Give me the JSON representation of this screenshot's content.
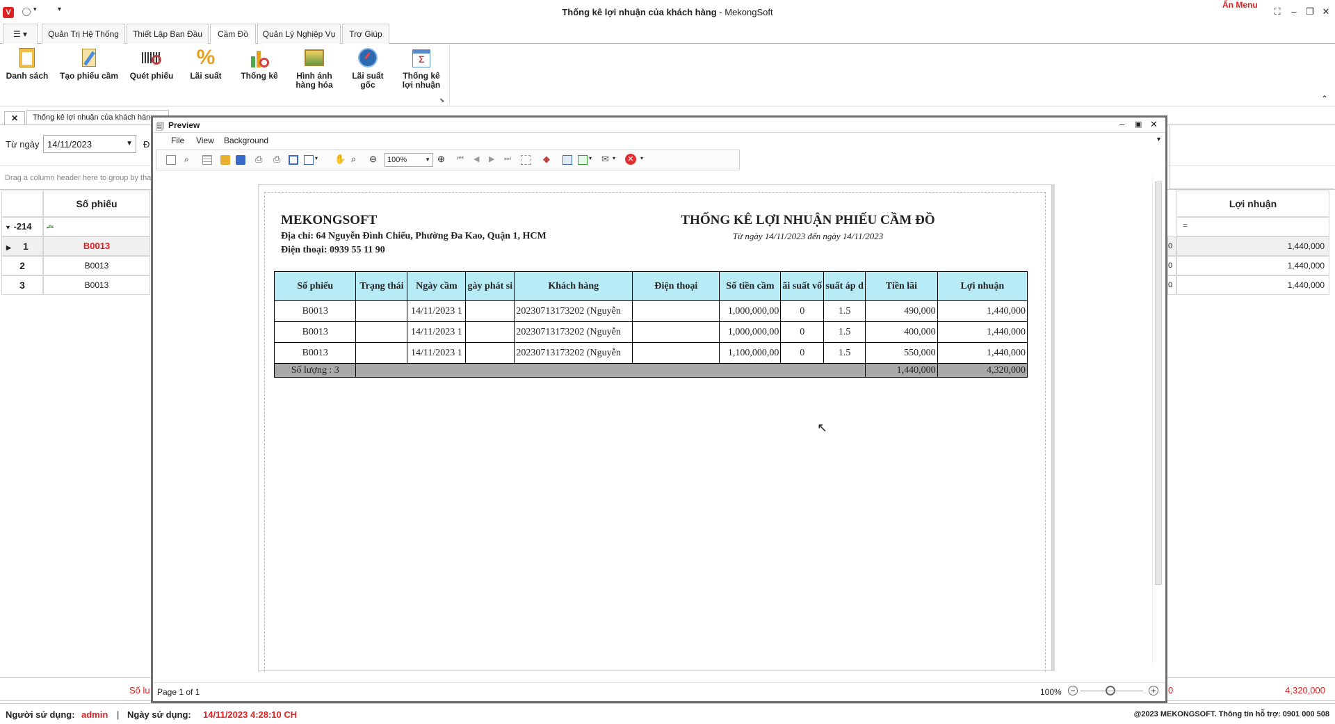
{
  "window": {
    "title_bold": "Thống kê lợi nhuận của khách hàng",
    "title_rest": " - MekongSoft",
    "an_menu": "Ẩn Menu"
  },
  "ribbon_tabs": [
    "Quản Trị Hệ Thống",
    "Thiết Lập Ban Đầu",
    "Cầm Đồ",
    "Quản Lý Nghiệp Vụ",
    "Trợ Giúp"
  ],
  "ribbon_buttons": [
    {
      "label": "Danh sách",
      "icon": "clipboard-icon"
    },
    {
      "label": "Tạo phiếu cầm",
      "icon": "edit-form-icon"
    },
    {
      "label": "Quét phiếu",
      "icon": "scan-barcode-icon"
    },
    {
      "label": "Lãi suất",
      "icon": "percent-icon"
    },
    {
      "label": "Thống kê",
      "icon": "chart-icon"
    },
    {
      "label": "Hình ảnh\nhàng hóa",
      "icon": "image-icon"
    },
    {
      "label": "Lãi suất\ngốc",
      "icon": "gauge-icon"
    },
    {
      "label": "Thống kê\nlợi nhuận",
      "icon": "sum-report-icon"
    }
  ],
  "doc_tab": {
    "close": "✕",
    "label": "Thống kê lợi nhuận của khách hàng"
  },
  "filter": {
    "from_label": "Từ ngày",
    "from_value": "14/11/2023",
    "to_label_partial": "Đ"
  },
  "grid": {
    "group_hint": "Drag a column header here to group by tha",
    "col_so_phieu": "Số phiếu",
    "col_loi_nhuan": "Lợi nhuận",
    "filter_row_value": "-214",
    "rows": [
      {
        "num": "1",
        "so_phieu": "B0013",
        "zero": "0",
        "loi_nhuan": "1,440,000"
      },
      {
        "num": "2",
        "so_phieu": "B0013",
        "zero": "0",
        "loi_nhuan": "1,440,000"
      },
      {
        "num": "3",
        "so_phieu": "B0013",
        "zero": "0",
        "loi_nhuan": "1,440,000"
      }
    ],
    "footer_left": "Số lu",
    "footer_mid": "0",
    "footer_total": "4,320,000"
  },
  "status": {
    "user_label": "Người sử dụng:",
    "user_value": "admin",
    "sep": "|",
    "date_label": "Ngày sử dụng:",
    "date_value": "14/11/2023 4:28:10 CH",
    "copyright": "@2023 MEKONGSOFT. Thông tin hỗ trợ: 0901 000 508"
  },
  "preview": {
    "title": "Preview",
    "menu": [
      "File",
      "View",
      "Background"
    ],
    "zoom_value": "100%",
    "page_info": "Page 1 of 1",
    "zoom_pct": "100%"
  },
  "report": {
    "company": "MEKONGSOFT",
    "address": "Địa chỉ: 64 Nguyễn Đình Chiểu, Phường Đa Kao, Quận 1, HCM",
    "phone": "Điện thoại: 0939 55 11 90",
    "title": "THỐNG KÊ LỢI NHUẬN PHIẾU CẦM ĐỒ",
    "subtitle": "Từ ngày 14/11/2023 đến ngày 14/11/2023",
    "headers": [
      "Số phiếu",
      "Trạng thái",
      "Ngày cầm",
      "gày phát si",
      "Khách hàng",
      "Điện thoại",
      "Số tiền cầm",
      "ãi suất vố",
      "suất áp d",
      "Tiền lãi",
      "Lợi nhuận"
    ],
    "rows": [
      [
        "B0013",
        "",
        "14/11/2023 1",
        "",
        "20230713173202 (Nguyễn",
        "",
        "1,000,000,00",
        "0",
        "1.5",
        "490,000",
        "1,440,000"
      ],
      [
        "B0013",
        "",
        "14/11/2023 1",
        "",
        "20230713173202 (Nguyễn",
        "",
        "1,000,000,00",
        "0",
        "1.5",
        "400,000",
        "1,440,000"
      ],
      [
        "B0013",
        "",
        "14/11/2023 1",
        "",
        "20230713173202 (Nguyễn",
        "",
        "1,100,000,00",
        "0",
        "1.5",
        "550,000",
        "1,440,000"
      ]
    ],
    "summary": {
      "count": "Số lượng : 3",
      "tien_lai": "1,440,000",
      "loi_nhuan": "4,320,000"
    }
  }
}
